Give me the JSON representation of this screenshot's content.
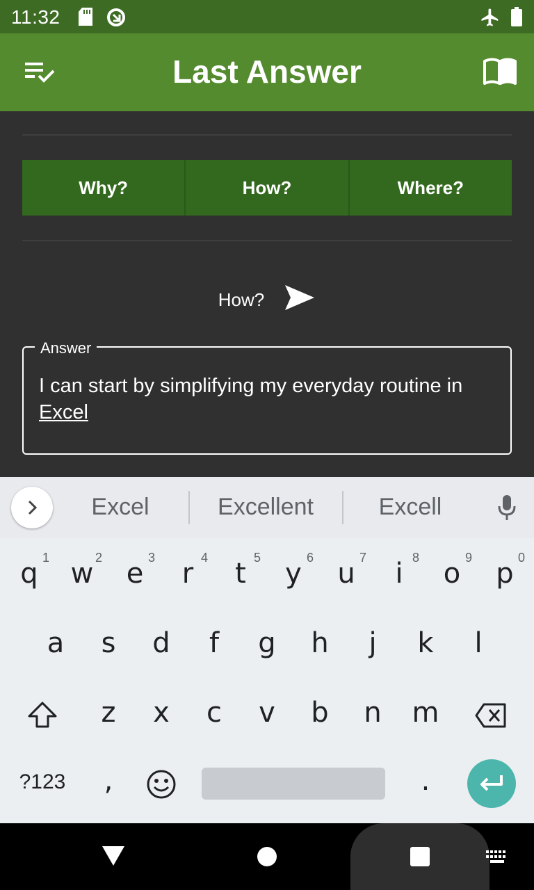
{
  "status_bar": {
    "time": "11:32"
  },
  "app_bar": {
    "title": "Last Answer",
    "left_icon": "checklist-icon",
    "right_icon": "book-icon"
  },
  "tabs": [
    {
      "label": "Why?"
    },
    {
      "label": "How?"
    },
    {
      "label": "Where?"
    }
  ],
  "question": {
    "text": "How?",
    "send_icon": "send-icon"
  },
  "answer": {
    "legend": "Answer",
    "text_before": "I can start by simplifying my everyday routine in ",
    "text_underlined": "Excel"
  },
  "keyboard": {
    "suggestions": [
      "Excel",
      "Excellent",
      "Excell"
    ],
    "row1": [
      "q",
      "w",
      "e",
      "r",
      "t",
      "y",
      "u",
      "i",
      "o",
      "p"
    ],
    "row1_numbers": [
      "1",
      "2",
      "3",
      "4",
      "5",
      "6",
      "7",
      "8",
      "9",
      "0"
    ],
    "row2": [
      "a",
      "s",
      "d",
      "f",
      "g",
      "h",
      "j",
      "k",
      "l"
    ],
    "row3": [
      "z",
      "x",
      "c",
      "v",
      "b",
      "n",
      "m"
    ],
    "symbols_key": "?123",
    "comma_key": ",",
    "period_key": ".",
    "accent": "#4db6ac"
  },
  "colors": {
    "status_bar": "#3d6b24",
    "app_bar": "#558b2f",
    "tab": "#33691e",
    "background": "#303030"
  }
}
